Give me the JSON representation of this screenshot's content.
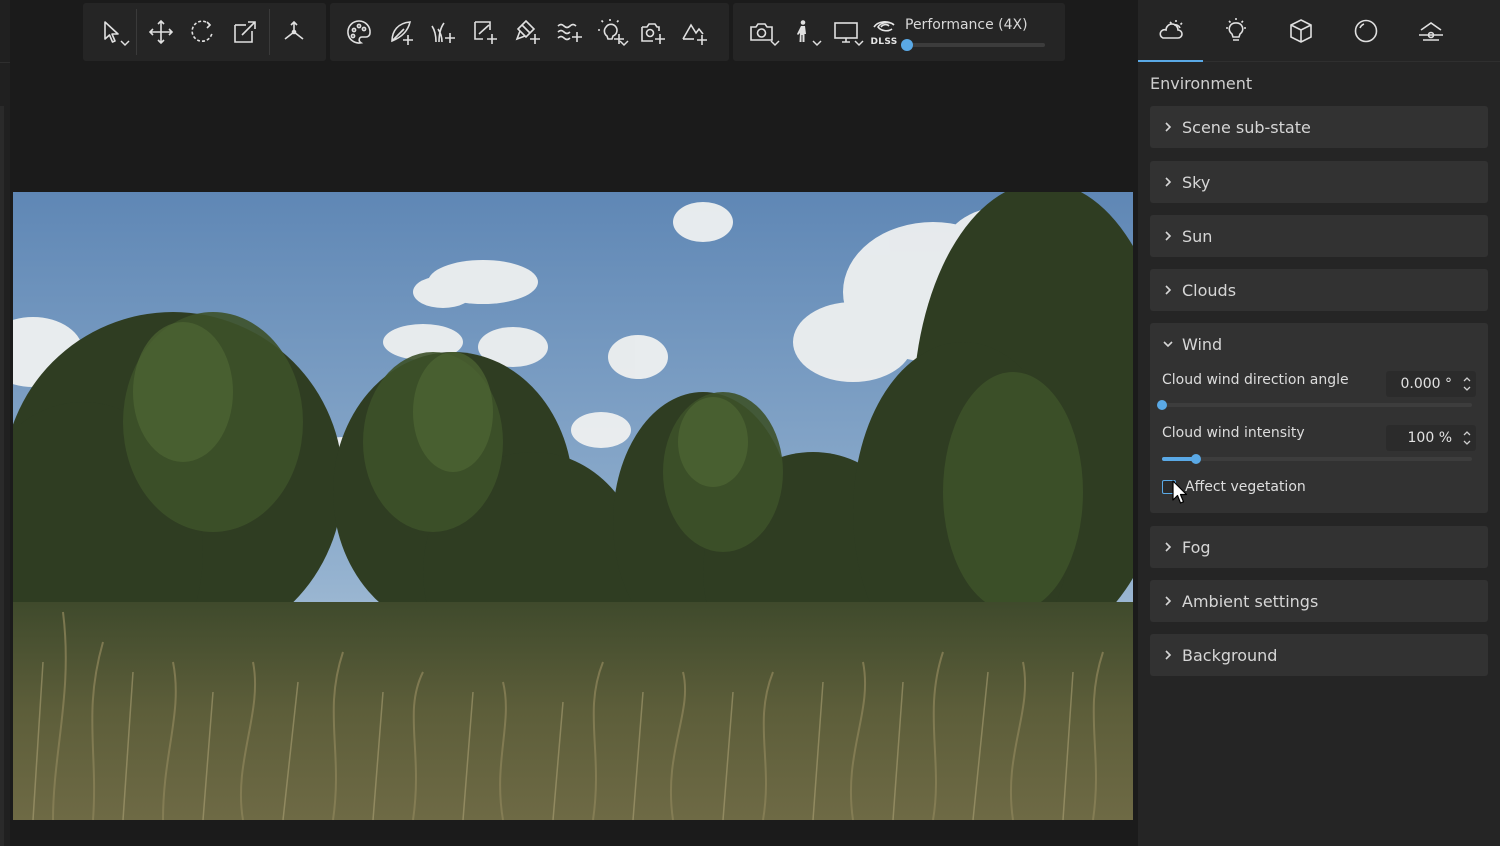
{
  "toolbar": {
    "select_tool": {
      "icon": "select-arrow-icon"
    },
    "move_tool": {
      "icon": "move-icon"
    },
    "rotate_tool": {
      "icon": "rotate-icon"
    },
    "scale_tool": {
      "icon": "scale-icon"
    },
    "transform_tool": {
      "icon": "axes-icon"
    },
    "object_tools": [
      {
        "icon": "materials-icon"
      },
      {
        "icon": "add-object-icon"
      },
      {
        "icon": "add-grass-icon"
      },
      {
        "icon": "add-path-icon"
      },
      {
        "icon": "add-paint-icon"
      },
      {
        "icon": "add-water-icon"
      },
      {
        "icon": "add-light-icon"
      },
      {
        "icon": "add-image-icon"
      },
      {
        "icon": "add-terrain-icon"
      }
    ],
    "render_tools": [
      {
        "icon": "camera-icon"
      },
      {
        "icon": "walk-icon"
      },
      {
        "icon": "monitor-icon"
      }
    ],
    "dlss": {
      "logo_text": "DLSS",
      "mode_label": "Performance (4X)",
      "level": 0.0
    }
  },
  "panel": {
    "tabs": [
      {
        "icon": "weather-icon",
        "active": true
      },
      {
        "icon": "light-bulb-icon",
        "active": false
      },
      {
        "icon": "cube-icon",
        "active": false
      },
      {
        "icon": "sphere-icon",
        "active": false
      },
      {
        "icon": "layers-icon",
        "active": false
      }
    ],
    "heading": "Environment",
    "sections": {
      "scene_sub_state": "Scene sub-state",
      "sky": "Sky",
      "sun": "Sun",
      "clouds": "Clouds",
      "wind": "Wind",
      "fog": "Fog",
      "ambient": "Ambient settings",
      "background": "Background"
    },
    "wind": {
      "direction_label": "Cloud wind direction angle",
      "direction_value": "0.000 °",
      "direction_level": 0.0,
      "intensity_label": "Cloud wind intensity",
      "intensity_value": "100 %",
      "intensity_level": 0.11,
      "affect_vegetation_label": "Affect vegetation",
      "affect_vegetation_checked": false
    }
  },
  "colors": {
    "accent": "#5aa9e6",
    "panel_bg": "#252525",
    "section_bg": "#323232",
    "app_bg": "#1b1b1b"
  }
}
